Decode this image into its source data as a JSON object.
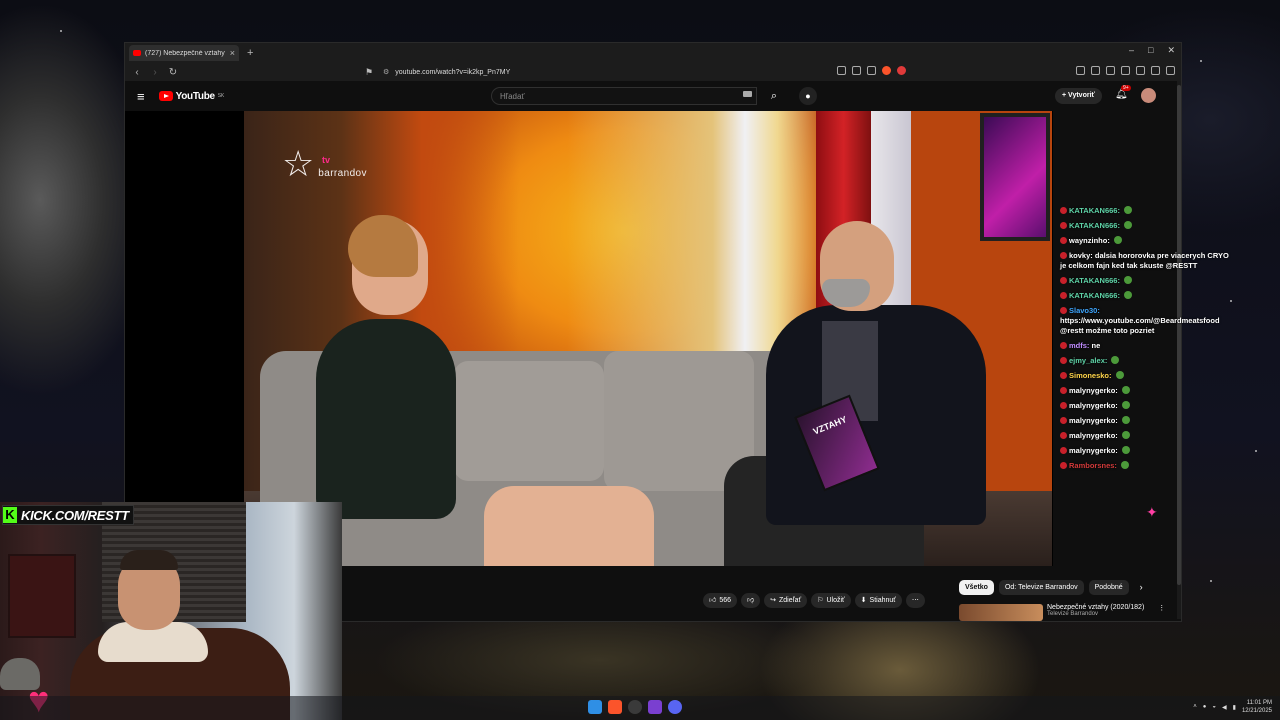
{
  "browser": {
    "tab_title": "(727) Nebezpečné vztahy (20",
    "url": "youtube.com/watch?v=ik2kp_Pn7MY"
  },
  "youtube": {
    "logo_text": "YouTube",
    "region": "SK",
    "search_placeholder": "Hľadať",
    "create_label": "Vytvoriť",
    "notification_count": "9+"
  },
  "video": {
    "watermark_text": "barrandov",
    "watermark_tv": "tv",
    "tablet_text": "VZTAHY"
  },
  "chat": {
    "messages": [
      {
        "user": "KATAKAN666:",
        "text": "",
        "color": "#5fd4a8"
      },
      {
        "user": "KATAKAN666:",
        "text": "",
        "color": "#5fd4a8"
      },
      {
        "user": "waynzinho:",
        "text": "",
        "color": "#ffffff"
      },
      {
        "user": "kovky:",
        "text": "dalsia hororovka pre viacerych CRYO je celkom fajn ked tak skuste @RESTT",
        "color": "#ffffff"
      },
      {
        "user": "KATAKAN666:",
        "text": "",
        "color": "#5fd4a8"
      },
      {
        "user": "KATAKAN666:",
        "text": "",
        "color": "#5fd4a8"
      },
      {
        "user": "Slavo30:",
        "text": "https://www.youtube.com/@Beardmeatsfood @restt možme toto pozriet",
        "color": "#3ea6ff"
      },
      {
        "user": "mdfs:",
        "text": "ne",
        "color": "#c08cff"
      },
      {
        "user": "ejmy_alex:",
        "text": "",
        "color": "#5fd4a8"
      },
      {
        "user": "Simonesko:",
        "text": "",
        "color": "#ffd54a"
      },
      {
        "user": "malynygerko:",
        "text": "",
        "color": "#ffffff"
      },
      {
        "user": "malynygerko:",
        "text": "",
        "color": "#ffffff"
      },
      {
        "user": "malynygerko:",
        "text": "",
        "color": "#ffffff"
      },
      {
        "user": "malynygerko:",
        "text": "",
        "color": "#ffffff"
      },
      {
        "user": "malynygerko:",
        "text": "",
        "color": "#ffffff"
      },
      {
        "user": "Ramborsnes:",
        "text": "",
        "color": "#d13a3a"
      }
    ]
  },
  "actions": {
    "likes": "566",
    "share": "Zdieľať",
    "save": "Uložiť",
    "download": "Stiahnuť"
  },
  "chips": {
    "all": "Všetko",
    "channel": "Od: Televize Barrandov",
    "similar": "Podobné"
  },
  "recommendation": {
    "title": "Nebezpečné vztahy (2020/182)",
    "channel": "Televize Barrandov"
  },
  "overlay": {
    "kick_text": "KICK.COM/RESTT"
  },
  "taskbar": {
    "time": "11:01 PM",
    "date": "12/21/2025"
  }
}
